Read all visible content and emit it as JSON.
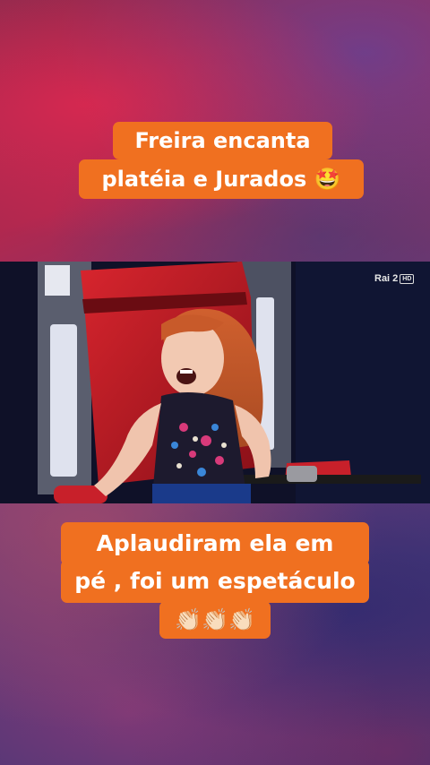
{
  "captions": {
    "top_line1": "Freira encanta",
    "top_line2": "platéia e Jurados 🤩",
    "bottom_line1": "Aplaudiram ela em",
    "bottom_line2": "pé , foi um espetáculo",
    "bottom_line3": "👏🏻👏🏻👏🏻"
  },
  "video": {
    "channel_logo": "Rai 2",
    "channel_badge": "HD"
  },
  "colors": {
    "caption_bg": "#f07020",
    "caption_text": "#ffffff",
    "chair_red": "#c8202a"
  }
}
